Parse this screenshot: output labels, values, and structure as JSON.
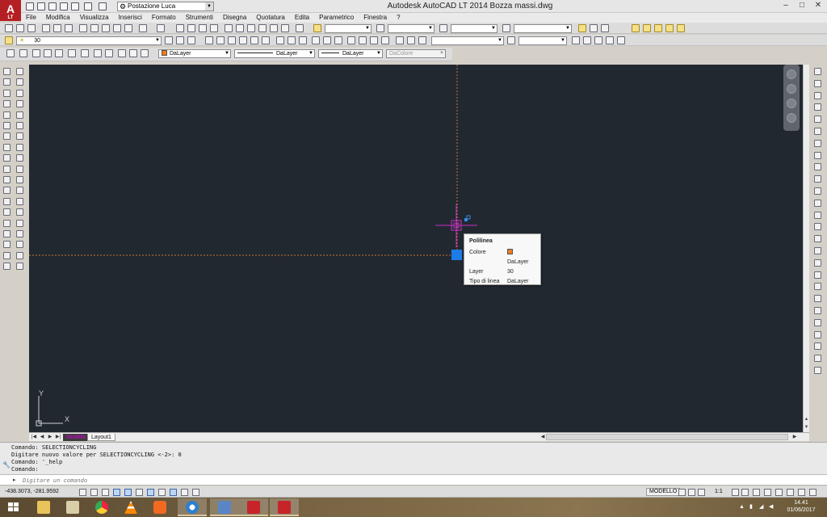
{
  "app": {
    "title": "Autodesk AutoCAD LT 2014    Bozza massi.dwg",
    "logo_letter": "A",
    "logo_sub": "LT",
    "workspace": "Postazione Luca"
  },
  "menu": [
    "File",
    "Modifica",
    "Visualizza",
    "Inserisci",
    "Formato",
    "Strumenti",
    "Disegna",
    "Quotatura",
    "Edita",
    "Parametrico",
    "Finestra",
    "?"
  ],
  "toolbar": {
    "layer_combo": "30",
    "color_combo": "DaLayer",
    "linetype_combo": "DaLayer",
    "lineweight_combo": "DaLayer",
    "plotstyle_combo": "DaColore"
  },
  "tabs": {
    "model": "Modello",
    "layout1": "Layout1"
  },
  "tooltip": {
    "title": "Polilinea",
    "rows": [
      {
        "key": "Colore",
        "value": "DaLayer"
      },
      {
        "key": "Layer",
        "value": "30"
      },
      {
        "key": "Tipo di linea",
        "value": "DaLayer"
      }
    ]
  },
  "command": {
    "history": [
      "Comando: SELECTIONCYCLING",
      "Digitare nuovo valore per SELECTIONCYCLING <-2>: 0",
      "Comando: '_help",
      "Comando:"
    ],
    "placeholder": "Digitare un comando"
  },
  "status": {
    "coords": "-438.3073, -281.9592",
    "model_label": "MODELLO",
    "scale_label": "1:1"
  },
  "ucs": {
    "x_label": "X",
    "y_label": "Y"
  },
  "clock": {
    "time": "14.41",
    "date": "01/06/2017"
  },
  "colors": {
    "canvas_bg": "#212830",
    "crosshair": "#c62fc6",
    "grip": "#1e7ce8",
    "layer_swatch": "#f07c1e"
  }
}
